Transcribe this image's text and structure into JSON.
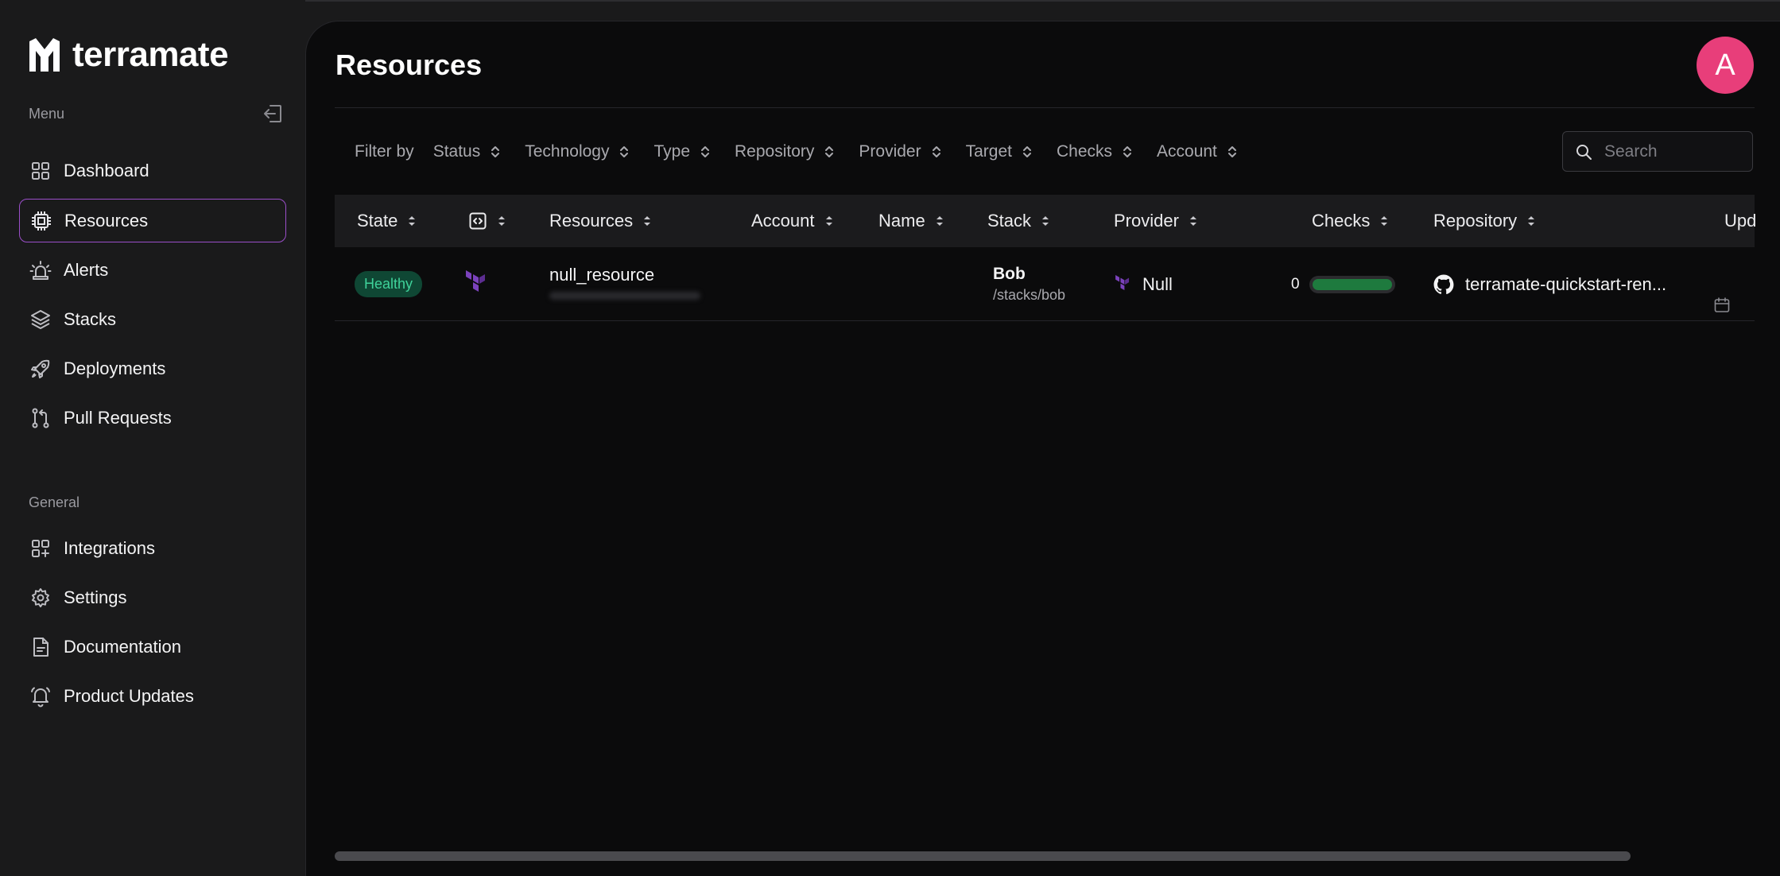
{
  "app": {
    "logo_text": "terramate"
  },
  "sidebar": {
    "menu_label": "Menu",
    "general_label": "General",
    "menu_items": [
      {
        "label": "Dashboard",
        "icon": "grid-icon"
      },
      {
        "label": "Resources",
        "icon": "chip-icon",
        "active": true
      },
      {
        "label": "Alerts",
        "icon": "siren-icon"
      },
      {
        "label": "Stacks",
        "icon": "layers-icon"
      },
      {
        "label": "Deployments",
        "icon": "rocket-icon"
      },
      {
        "label": "Pull Requests",
        "icon": "git-pull-request-icon"
      }
    ],
    "general_items": [
      {
        "label": "Integrations",
        "icon": "grid-plus-icon"
      },
      {
        "label": "Settings",
        "icon": "gear-icon"
      },
      {
        "label": "Documentation",
        "icon": "document-icon"
      },
      {
        "label": "Product Updates",
        "icon": "bell-icon"
      }
    ]
  },
  "header": {
    "title": "Resources",
    "avatar_initial": "A"
  },
  "filters": {
    "label": "Filter by",
    "items": [
      "Status",
      "Technology",
      "Type",
      "Repository",
      "Provider",
      "Target",
      "Checks",
      "Account"
    ]
  },
  "search": {
    "placeholder": "Search",
    "value": ""
  },
  "table": {
    "columns": [
      "State",
      "",
      "Resources",
      "Account",
      "Name",
      "Stack",
      "Provider",
      "Checks",
      "Repository",
      "Upd"
    ],
    "rows": [
      {
        "state": "Healthy",
        "technology_icon": "terraform-icon",
        "resource": "null_resource",
        "account": "",
        "name": "",
        "stack_name": "Bob",
        "stack_path": "/stacks/bob",
        "provider": "Null",
        "checks_count": "0",
        "checks_progress": 1.0,
        "repository": "terramate-quickstart-ren...",
        "updated_icon": "calendar-icon"
      }
    ]
  },
  "colors": {
    "accent": "#9b4fc9",
    "healthy_bg": "#0f4734",
    "healthy_text": "#3fd29a",
    "avatar": "#e83e7a",
    "terraform": "#7b42bc",
    "check_bar": "#1e7a3e"
  }
}
